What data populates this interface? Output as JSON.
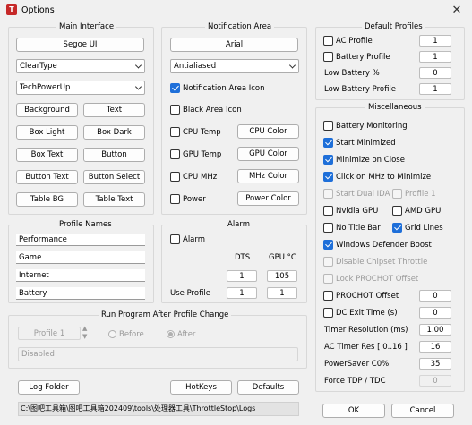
{
  "window": {
    "title": "Options",
    "icon_text": "T",
    "close_glyph": "✕"
  },
  "main_interface": {
    "title": "Main Interface",
    "font_button": "Segoe UI",
    "render_select": "ClearType",
    "skin_select": "TechPowerUp",
    "color_buttons": [
      [
        "Background",
        "Text"
      ],
      [
        "Box Light",
        "Box Dark"
      ],
      [
        "Box Text",
        "Button"
      ],
      [
        "Button Text",
        "Button Select"
      ],
      [
        "Table BG",
        "Table Text"
      ]
    ]
  },
  "notification": {
    "title": "Notification Area",
    "font_button": "Arial",
    "aa_select": "Antialiased",
    "notif_icon": {
      "label": "Notification Area Icon",
      "checked": true
    },
    "black_area": {
      "label": "Black Area Icon",
      "checked": false
    },
    "rows": [
      {
        "label": "CPU Temp",
        "button": "CPU Color"
      },
      {
        "label": "GPU Temp",
        "button": "GPU Color"
      },
      {
        "label": "CPU MHz",
        "button": "MHz Color"
      },
      {
        "label": "Power",
        "button": "Power Color"
      }
    ]
  },
  "default_profiles": {
    "title": "Default Profiles",
    "rows": [
      {
        "label": "AC Profile",
        "value": "1",
        "checkbox": true
      },
      {
        "label": "Battery Profile",
        "value": "1",
        "checkbox": true
      },
      {
        "label": "Low Battery %",
        "value": "0",
        "checkbox": false
      },
      {
        "label": "Low Battery Profile",
        "value": "1",
        "checkbox": false
      }
    ]
  },
  "misc": {
    "title": "Miscellaneous",
    "battery_monitoring": {
      "label": "Battery Monitoring",
      "checked": false
    },
    "start_minimized": {
      "label": "Start Minimized",
      "checked": true
    },
    "minimize_close": {
      "label": "Minimize on Close",
      "checked": true
    },
    "click_mhz": {
      "label": "Click on MHz to Minimize",
      "checked": true
    },
    "start_dual_ida": {
      "label": "Start Dual IDA",
      "checked": false
    },
    "profile1": {
      "label": "Profile 1",
      "checked": false
    },
    "nvidia_gpu": {
      "label": "Nvidia GPU",
      "checked": false
    },
    "amd_gpu": {
      "label": "AMD GPU",
      "checked": false
    },
    "no_title_bar": {
      "label": "No Title Bar",
      "checked": false
    },
    "grid_lines": {
      "label": "Grid Lines",
      "checked": true
    },
    "windows_defender": {
      "label": "Windows Defender Boost",
      "checked": true
    },
    "disable_chipset": {
      "label": "Disable Chipset Throttle",
      "checked": false
    },
    "lock_prochot": {
      "label": "Lock PROCHOT Offset",
      "checked": false
    },
    "prochot_offset": {
      "label": "PROCHOT Offset",
      "value": "0",
      "checked": false
    },
    "dc_exit": {
      "label": "DC Exit Time (s)",
      "value": "0",
      "checked": false
    },
    "timer_res": {
      "label": "Timer Resolution (ms)",
      "value": "1.00"
    },
    "ac_timer": {
      "label": "AC Timer Res [ 0..16 ]",
      "value": "16"
    },
    "powersaver": {
      "label": "PowerSaver C0%",
      "value": "35"
    },
    "force_tdp": {
      "label": "Force TDP / TDC",
      "value": "0"
    }
  },
  "profile_names": {
    "title": "Profile Names",
    "names": [
      "Performance",
      "Game",
      "Internet",
      "Battery"
    ]
  },
  "alarm": {
    "title": "Alarm",
    "alarm_cb": {
      "label": "Alarm",
      "checked": false
    },
    "dts_label": "DTS",
    "gpu_label": "GPU °C",
    "dts_value": "1",
    "gpu_value": "105",
    "use_profile": "Use Profile",
    "use_dts": "1",
    "use_gpu": "1"
  },
  "run_program": {
    "title": "Run Program After Profile Change",
    "profile_select": "Profile 1",
    "before": "Before",
    "after": "After",
    "disabled_text": "Disabled"
  },
  "bottom": {
    "log_folder": "Log Folder",
    "hotkeys": "HotKeys",
    "defaults": "Defaults",
    "path": "C:\\图吧工具箱\\图吧工具箱202409\\tools\\处理器工具\\ThrottleStop\\Logs",
    "ok": "OK",
    "cancel": "Cancel"
  }
}
